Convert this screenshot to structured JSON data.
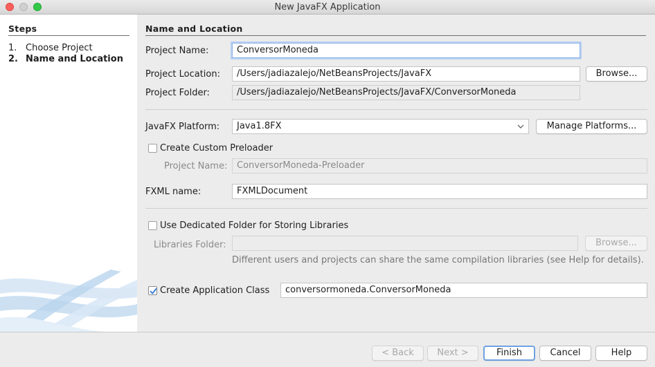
{
  "window": {
    "title": "New JavaFX Application"
  },
  "steps": {
    "title": "Steps",
    "items": [
      {
        "num": "1.",
        "label": "Choose Project"
      },
      {
        "num": "2.",
        "label": "Name and Location"
      }
    ]
  },
  "main": {
    "section_title": "Name and Location",
    "project_name_label": "Project Name:",
    "project_name_value": "ConversorMoneda",
    "project_location_label": "Project Location:",
    "project_location_value": "/Users/jadiazalejo/NetBeansProjects/JavaFX",
    "browse_label": "Browse...",
    "project_folder_label": "Project Folder:",
    "project_folder_value": "/Users/jadiazalejo/NetBeansProjects/JavaFX/ConversorMoneda",
    "platform_label": "JavaFX Platform:",
    "platform_value": "Java1.8FX",
    "manage_platforms_label": "Manage Platforms...",
    "preloader_checkbox_label": "Create Custom Preloader",
    "preloader_checked": false,
    "preloader_name_label": "Project Name:",
    "preloader_name_value": "ConversorMoneda-Preloader",
    "fxml_label": "FXML name:",
    "fxml_value": "FXMLDocument",
    "libraries_checkbox_label": "Use Dedicated Folder for Storing Libraries",
    "libraries_checked": false,
    "libraries_folder_label": "Libraries Folder:",
    "libraries_folder_value": "",
    "libraries_browse_label": "Browse...",
    "libraries_hint": "Different users and projects can share the same compilation libraries (see Help for details).",
    "app_class_checkbox_label": "Create Application Class",
    "app_class_checked": true,
    "app_class_value": "conversormoneda.ConversorMoneda"
  },
  "footer": {
    "back_label": "< Back",
    "next_label": "Next >",
    "finish_label": "Finish",
    "cancel_label": "Cancel",
    "help_label": "Help"
  }
}
